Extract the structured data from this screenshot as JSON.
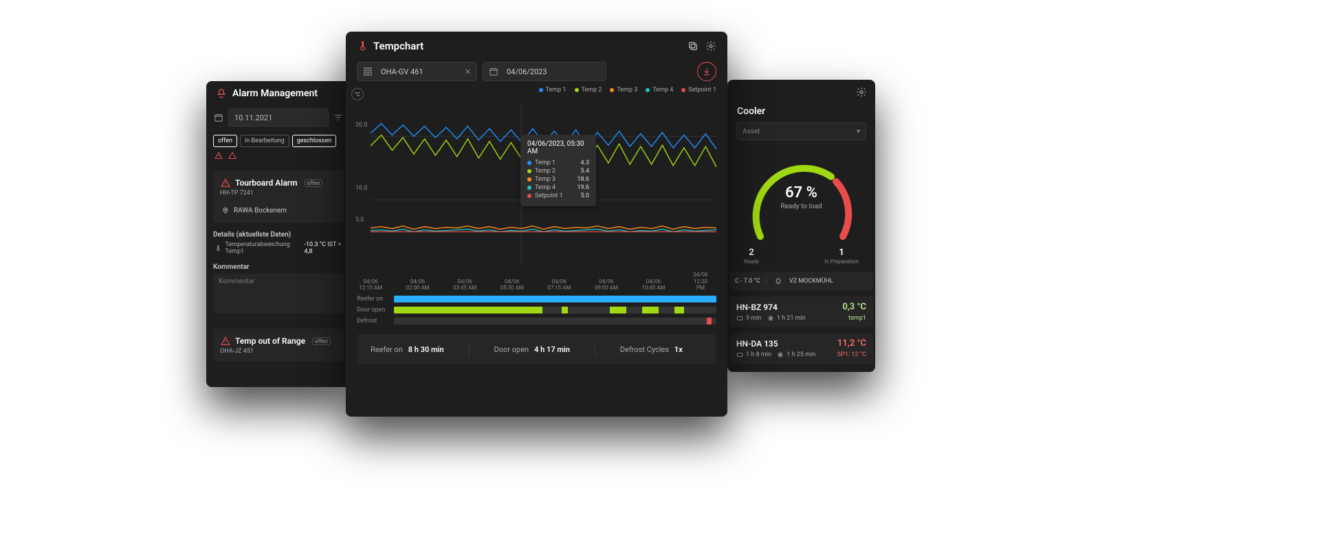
{
  "alarm": {
    "title": "Alarm Management",
    "date": "10.11.2021",
    "tabs": [
      "offen",
      "in Bearbeitung",
      "geschlossen"
    ],
    "item1": {
      "title": "Tourboard Alarm",
      "status": "offen",
      "asset": "HH-TP 7241",
      "location": "RAWA Bockenem"
    },
    "details_hdr": "Details (aktuellste Daten)",
    "details_line": "Temperaturabweichung Temp1",
    "details_vals": "-10.3 °C IST = 4,8",
    "comment_hdr": "Kommentar",
    "comment_ph": "Kommentar",
    "item2": {
      "title": "Temp out of Range",
      "status": "offen",
      "asset": "OHA-JZ 451"
    }
  },
  "tempchart": {
    "title": "Tempchart",
    "asset": "OHA-GV 461",
    "date": "04/06/2023",
    "unit": "°C",
    "legend": [
      "Temp 1",
      "Temp 2",
      "Temp 3",
      "Temp 4",
      "Setpoint 1"
    ],
    "tooltip": {
      "ts": "04/06/2023, 05:30 AM",
      "rows": [
        {
          "label": "Temp 1",
          "val": "4.3",
          "color": "#1e90ff"
        },
        {
          "label": "Temp 2",
          "val": "5.4",
          "color": "#a0d911"
        },
        {
          "label": "Temp 3",
          "val": "18.6",
          "color": "#ff8c1a"
        },
        {
          "label": "Temp 4",
          "val": "19.6",
          "color": "#1fc2c2"
        },
        {
          "label": "Setpoint 1",
          "val": "5.0",
          "color": "#e84c4c"
        }
      ]
    },
    "bars": {
      "reefer": "Reefer on",
      "door": "Door open",
      "defrost": "Defrost"
    },
    "stats": {
      "reefer_lbl": "Reefer on",
      "reefer_val": "8 h 30 min",
      "door_lbl": "Door open",
      "door_val": "4 h 17 min",
      "defrost_lbl": "Defrost Cycles",
      "defrost_val": "1x"
    }
  },
  "chart_data": {
    "type": "line",
    "title": "Tempchart",
    "ylabel": "°C",
    "ylim": [
      0,
      25
    ],
    "yticks": [
      5.0,
      10.0,
      20.0
    ],
    "xticks": [
      "04/06\n12:15 AM",
      "04/06\n02:00 AM",
      "04/06\n03:45 AM",
      "04/06\n05:30 AM",
      "04/06\n07:15 AM",
      "04/06\n09:00 AM",
      "04/06\n10:45 AM",
      "04/06\n12:30 PM"
    ],
    "series": [
      {
        "name": "Temp 1",
        "color": "#1e90ff",
        "values": [
          20.5,
          22.0,
          20.2,
          21.8,
          20.0,
          21.6,
          19.8,
          21.4,
          19.6,
          21.6,
          19.4,
          21.2,
          19.2,
          21.0,
          19.0,
          21.2,
          19.0,
          20.8,
          18.8,
          21.0,
          18.6,
          20.6,
          18.6,
          20.8,
          18.4,
          20.4,
          18.4,
          20.6,
          18.2,
          20.2,
          18.2,
          20.4,
          18.0
        ]
      },
      {
        "name": "Temp 2",
        "color": "#a0d911",
        "values": [
          18.5,
          20.2,
          17.8,
          19.8,
          17.2,
          19.6,
          17.0,
          19.4,
          16.8,
          19.6,
          16.6,
          19.2,
          16.4,
          19.0,
          16.4,
          19.2,
          16.2,
          18.8,
          16.0,
          19.0,
          15.8,
          18.6,
          15.8,
          18.8,
          15.6,
          18.4,
          15.6,
          18.6,
          15.4,
          18.2,
          15.4,
          18.4,
          15.2
        ]
      },
      {
        "name": "Temp 3",
        "color": "#ff8c1a",
        "values": [
          5.6,
          5.8,
          5.5,
          5.9,
          5.4,
          5.8,
          5.5,
          5.7,
          5.6,
          5.9,
          5.5,
          5.8,
          5.4,
          5.7,
          5.5,
          5.9,
          5.4,
          5.8,
          5.5,
          5.7,
          5.6,
          5.9,
          5.5,
          5.8,
          5.4,
          5.7,
          5.5,
          5.9,
          5.4,
          5.8,
          5.5,
          5.7,
          5.6
        ]
      },
      {
        "name": "Temp 4",
        "color": "#1fc2c2",
        "values": [
          5.2,
          5.3,
          5.1,
          5.4,
          5.0,
          5.3,
          5.1,
          5.2,
          5.3,
          5.4,
          5.1,
          5.3,
          5.0,
          5.2,
          5.1,
          5.4,
          5.0,
          5.3,
          5.1,
          5.2,
          5.3,
          5.4,
          5.1,
          5.3,
          5.0,
          5.2,
          5.1,
          5.4,
          5.0,
          5.3,
          5.1,
          5.2,
          5.3
        ]
      },
      {
        "name": "Setpoint 1",
        "color": "#e84c4c",
        "values": [
          5.0,
          5.0,
          5.0,
          5.0,
          5.0,
          5.0,
          5.0,
          5.0,
          5.0,
          5.0,
          5.0,
          5.0,
          5.0,
          5.0,
          5.0,
          5.0,
          5.0,
          5.0,
          5.0,
          5.0,
          5.0,
          5.0,
          5.0,
          5.0,
          5.0,
          5.0,
          5.0,
          5.0,
          5.0,
          5.0,
          5.0,
          5.0,
          5.0
        ]
      }
    ]
  },
  "cooler": {
    "title": "Cooler",
    "asset_ph": "Asset",
    "gauge": {
      "pct": "67 %",
      "sub": "Ready to load",
      "ready": "2",
      "ready_lbl": "Ready",
      "prep": "1",
      "prep_lbl": "In Preparation"
    },
    "range": "C - 7.0 °C",
    "location": "VZ MOCKMÜHL",
    "assets": [
      {
        "id": "HN-BZ 974",
        "temp": "0,3 °C",
        "time1": "9 min",
        "time2": "1 h 21 min",
        "sub": "temp1",
        "tempClass": "lime-txt"
      },
      {
        "id": "HN-DA 135",
        "temp": "11,2 °C",
        "time1": "1 h 8 min",
        "time2": "1 h 25 min",
        "sub": "SP1: 12 °C",
        "tempClass": "red-txt"
      }
    ]
  }
}
